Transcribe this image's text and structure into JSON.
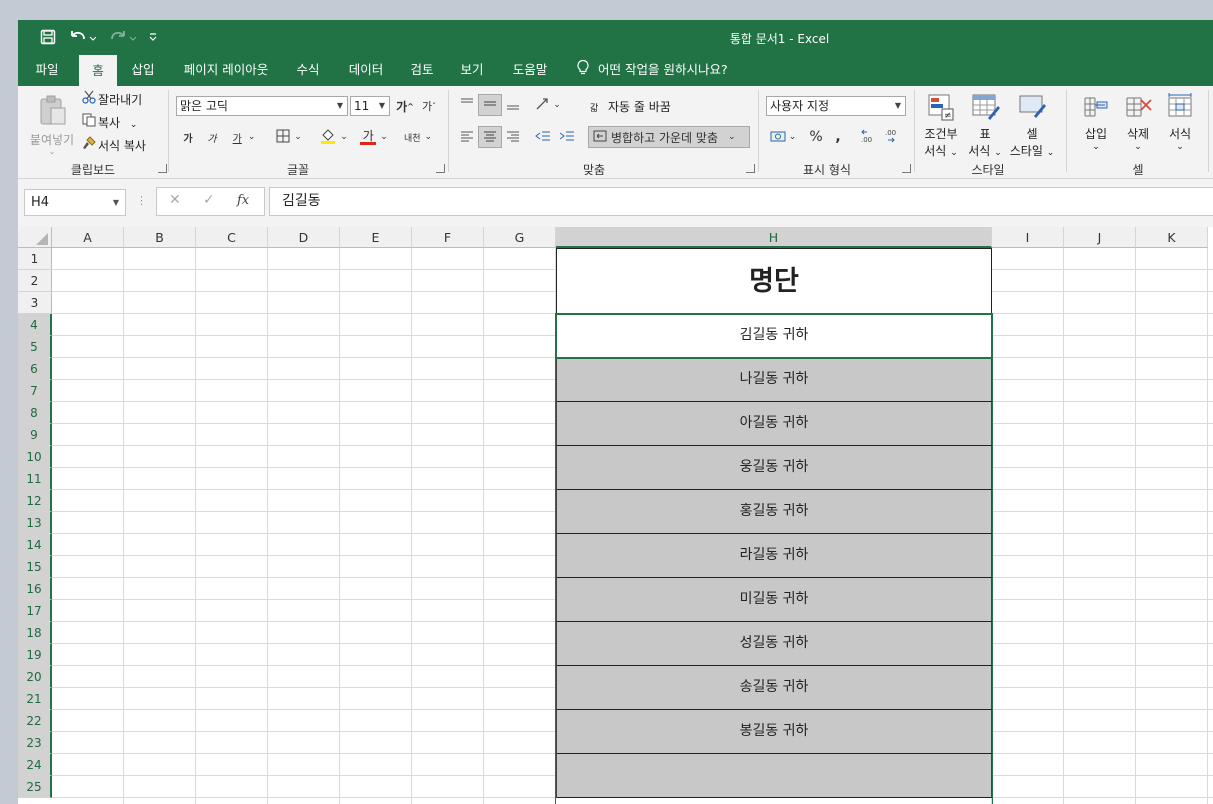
{
  "title_bar": {
    "doc_title": "통합 문서1  -  Excel",
    "icons": [
      "save-icon",
      "undo-icon",
      "redo-icon",
      "customize-qat-icon"
    ]
  },
  "tabs": [
    "파일",
    "홈",
    "삽입",
    "페이지 레이아웃",
    "수식",
    "데이터",
    "검토",
    "보기",
    "도움말"
  ],
  "active_tab": "홈",
  "tell_me": "어떤 작업을 원하시나요?",
  "ribbon": {
    "clipboard": {
      "paste": "붙여넣기",
      "cut": "잘라내기",
      "copy": "복사",
      "format_painter": "서식 복사",
      "label": "클립보드"
    },
    "font": {
      "name": "맑은 고딕",
      "size": "11",
      "grow": "가",
      "shrink": "가",
      "bold": "가",
      "italic": "가",
      "underline": "가",
      "color_glyph": "가",
      "phonetic": "내천",
      "label": "글꼴"
    },
    "alignment": {
      "wrap": "자동 줄 바꿈",
      "merge": "병합하고 가운데 맞춤",
      "label": "맞춤"
    },
    "number": {
      "format": "사용자 지정",
      "percent": "%",
      "comma": ",",
      "label": "표시 형식"
    },
    "styles": {
      "conditional_l1": "조건부",
      "conditional_l2": "서식",
      "table_l1": "표",
      "table_l2": "서식",
      "cell_l1": "셀",
      "cell_l2": "스타일",
      "label": "스타일"
    },
    "cells": {
      "insert": "삽입",
      "delete": "삭제",
      "format": "서식",
      "label": "셀"
    }
  },
  "formula_bar": {
    "name_box": "H4",
    "fx": "fx",
    "value": "김길동"
  },
  "accent": "#217346",
  "sheet": {
    "columns": [
      "A",
      "B",
      "C",
      "D",
      "E",
      "F",
      "G",
      "H",
      "I",
      "J",
      "K"
    ],
    "selected_column": "H",
    "rows": [
      "1",
      "2",
      "3",
      "4",
      "5",
      "6",
      "7",
      "8",
      "9",
      "10",
      "11",
      "12",
      "13",
      "14",
      "15",
      "16",
      "17",
      "18",
      "19",
      "20",
      "21",
      "22",
      "23",
      "24",
      "25"
    ],
    "selected_rows": [
      "4",
      "5",
      "6",
      "7",
      "8",
      "9",
      "10",
      "11",
      "12",
      "13",
      "14",
      "15",
      "16",
      "17",
      "18",
      "19",
      "20",
      "21",
      "22",
      "23",
      "24",
      "25"
    ],
    "selected_range": "H4",
    "header_cell": "명단",
    "entries": [
      "김길동 귀하",
      "나길동 귀하",
      "아길동 귀하",
      "웅길동 귀하",
      "홍길동 귀하",
      "라길동 귀하",
      "미길동 귀하",
      "성길동 귀하",
      "송길동 귀하",
      "봉길동 귀하",
      ""
    ],
    "fill_color": "#c8c8c8"
  }
}
